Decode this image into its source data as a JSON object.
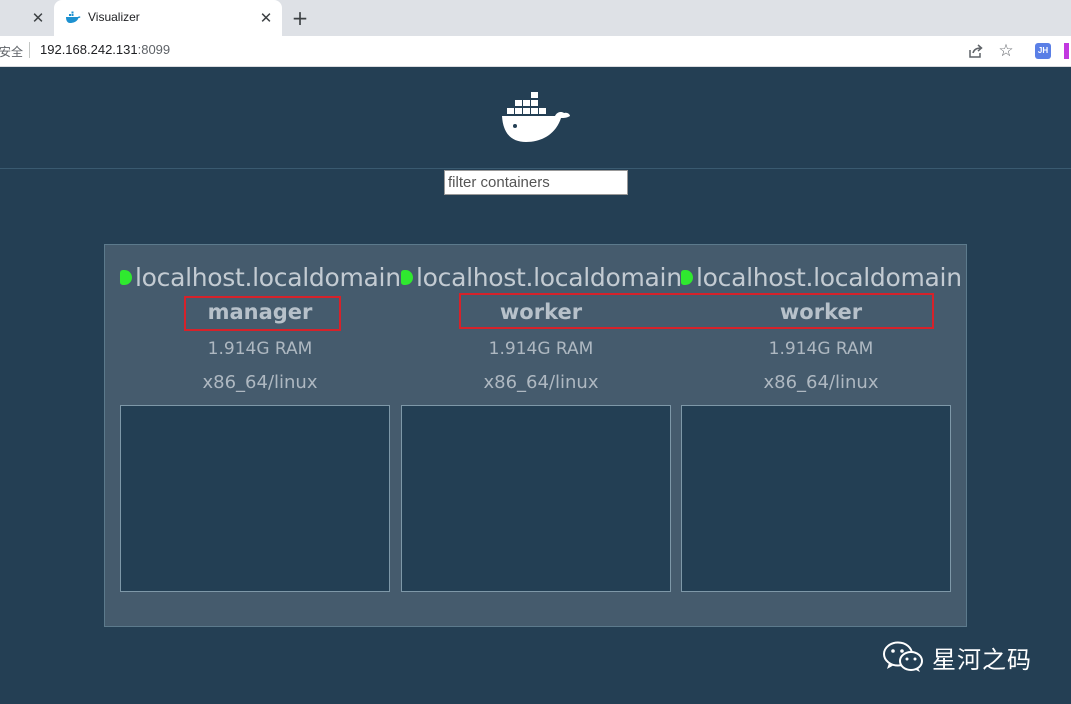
{
  "browser": {
    "tab_title": "Visualizer",
    "prev_tab_close": "✕",
    "tab_close": "✕",
    "new_tab": "+",
    "security_label": "安全",
    "url_host": "192.168.242.131",
    "url_port": ":8099",
    "extension_label": "JH",
    "bookmark_star": "☆"
  },
  "page": {
    "filter_placeholder": "filter containers",
    "nodes": [
      {
        "hostname": "localhost.localdomain",
        "role": "manager",
        "ram": "1.914G RAM",
        "os": "x86_64/linux",
        "status": "ready"
      },
      {
        "hostname": "localhost.localdomain",
        "role": "worker",
        "ram": "1.914G RAM",
        "os": "x86_64/linux",
        "status": "ready"
      },
      {
        "hostname": "localhost.localdomain",
        "role": "worker",
        "ram": "1.914G RAM",
        "os": "x86_64/linux",
        "status": "ready"
      }
    ]
  },
  "watermark": {
    "text": "星河之码"
  },
  "colors": {
    "page_background": "#243f54",
    "cluster_background": "#455b6d",
    "status_ready": "#2fe92f",
    "annotation_red": "#d6222a"
  }
}
